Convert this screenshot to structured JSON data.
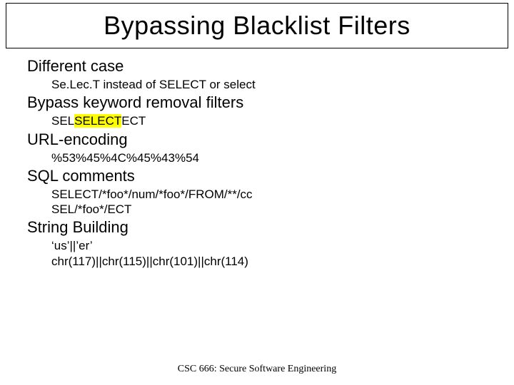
{
  "title": "Bypassing Blacklist Filters",
  "sections": {
    "s0": {
      "heading": "Different case",
      "lines": [
        "Se.Lec.T instead of SELECT or select"
      ]
    },
    "s1": {
      "heading": "Bypass keyword removal filters",
      "lines_pre": "SEL",
      "lines_hl": "SELECT",
      "lines_post": "ECT"
    },
    "s2": {
      "heading": "URL-encoding",
      "lines": [
        "%53%45%4C%45%43%54"
      ]
    },
    "s3": {
      "heading": "SQL comments",
      "lines": [
        "SELECT/*foo*/num/*foo*/FROM/**/cc",
        "SEL/*foo*/ECT"
      ]
    },
    "s4": {
      "heading": "String Building",
      "lines": [
        "‘us’||’er’",
        "chr(117)||chr(115)||chr(101)||chr(114)"
      ]
    }
  },
  "footer": "CSC 666: Secure Software Engineering"
}
